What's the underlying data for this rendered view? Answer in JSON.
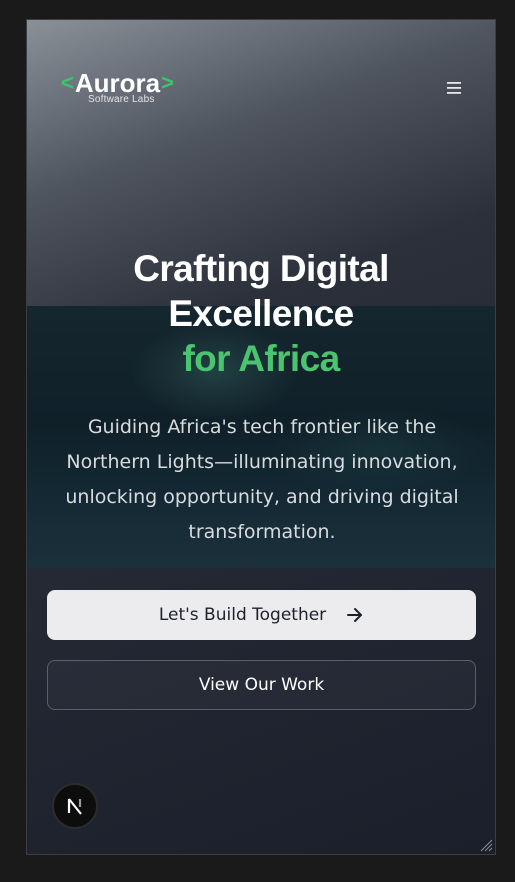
{
  "header": {
    "logo": {
      "bracket_open": "<",
      "name": "Aurora",
      "bracket_close": ">",
      "tagline": "Software Labs"
    },
    "menu_icon": "hamburger-menu-icon"
  },
  "hero": {
    "headline_line1": "Crafting Digital",
    "headline_line2": "Excellence",
    "headline_accent": "for Africa",
    "description": "Guiding Africa's tech frontier like the Northern Lights—illuminating innovation, unlocking opportunity, and driving digital transformation.",
    "primary_button": {
      "label": "Let's Build Together",
      "icon": "arrow-right-icon"
    },
    "secondary_button": {
      "label": "View Our Work"
    }
  },
  "overlay": {
    "badge_letter": "N",
    "badge_icon": "nextjs-logo-icon"
  },
  "colors": {
    "accent_green": "#4bc46f",
    "primary_button_bg": "#ececef",
    "background": "#232833"
  }
}
